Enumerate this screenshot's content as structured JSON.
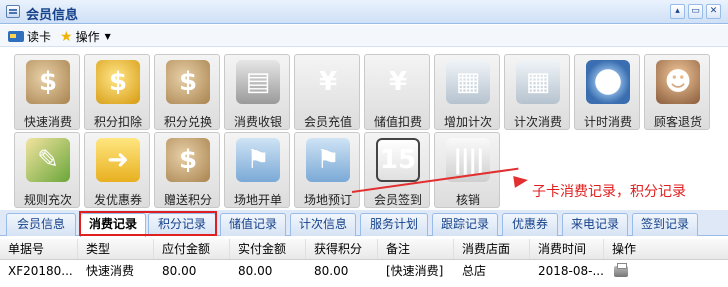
{
  "window": {
    "title": "会员信息",
    "min_label": "▴",
    "max_label": "▭",
    "close_label": "✕"
  },
  "toolbar": {
    "read_card": "读卡",
    "operate": "操作"
  },
  "tiles": [
    {
      "label": "快速消费",
      "icon": "money-bag-icon",
      "glyph": "$"
    },
    {
      "label": "积分扣除",
      "icon": "coin-stack-icon",
      "glyph": "$"
    },
    {
      "label": "积分兑换",
      "icon": "money-bag-exchange-icon",
      "glyph": "$"
    },
    {
      "label": "消费收银",
      "icon": "cash-register-icon",
      "glyph": "▤"
    },
    {
      "label": "会员充值",
      "icon": "yen-add-icon",
      "glyph": "¥"
    },
    {
      "label": "储值扣费",
      "icon": "yen-minus-icon",
      "glyph": "¥"
    },
    {
      "label": "增加计次",
      "icon": "calculator-add-icon",
      "glyph": "▦"
    },
    {
      "label": "计次消费",
      "icon": "calculator-icon",
      "glyph": "▦"
    },
    {
      "label": "计时消费",
      "icon": "clock-coins-icon",
      "glyph": "◷"
    },
    {
      "label": "顾客退货",
      "icon": "user-return-icon",
      "glyph": "☻"
    },
    {
      "label": "规则充次",
      "icon": "pen-rule-icon",
      "glyph": "✎"
    },
    {
      "label": "发优惠券",
      "icon": "ticket-icon",
      "glyph": "➜"
    },
    {
      "label": "赠送积分",
      "icon": "money-bag-gift-icon",
      "glyph": "$"
    },
    {
      "label": "场地开单",
      "icon": "field-flag-icon",
      "glyph": "⚑"
    },
    {
      "label": "场地预订",
      "icon": "field-booking-icon",
      "glyph": "⚑"
    },
    {
      "label": "会员签到",
      "icon": "calendar-icon",
      "glyph": "15"
    },
    {
      "label": "核销",
      "icon": "barcode-icon",
      "glyph": "||||"
    }
  ],
  "annotation": "子卡消费记录，积分记录",
  "tabs": [
    {
      "label": "会员信息"
    },
    {
      "label": "消费记录"
    },
    {
      "label": "积分记录"
    },
    {
      "label": "储值记录"
    },
    {
      "label": "计次信息"
    },
    {
      "label": "服务计划"
    },
    {
      "label": "跟踪记录"
    },
    {
      "label": "优惠券"
    },
    {
      "label": "来电记录"
    },
    {
      "label": "签到记录"
    }
  ],
  "table": {
    "columns": [
      "单据号",
      "类型",
      "应付金额",
      "实付金额",
      "获得积分",
      "备注",
      "消费店面",
      "消费时间",
      "操作"
    ],
    "rows": [
      [
        "XF20180...",
        "快速消费",
        "80.00",
        "80.00",
        "80.00",
        "[快速消费]",
        "总店",
        "2018-08-..."
      ]
    ]
  },
  "colors": {
    "accent": "#15428b",
    "highlight": "#e02020"
  }
}
